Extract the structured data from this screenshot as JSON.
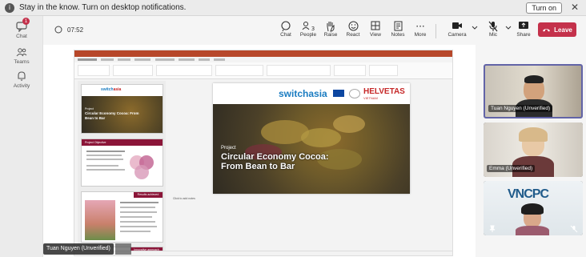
{
  "notification": {
    "text": "Stay in the know. Turn on desktop notifications.",
    "turn_on": "Turn on",
    "close": "✕",
    "info_glyph": "i"
  },
  "rail": {
    "items": [
      {
        "label": "Chat",
        "badge": "1",
        "icon": "chat-icon"
      },
      {
        "label": "Teams",
        "icon": "teams-icon"
      },
      {
        "label": "Activity",
        "icon": "bell-icon"
      }
    ]
  },
  "meeting": {
    "timer": "07:52",
    "toolbar": [
      {
        "label": "Chat",
        "icon": "chat-icon",
        "glyph": "💬"
      },
      {
        "label": "People",
        "icon": "people-icon",
        "glyph": "👥",
        "count": "3"
      },
      {
        "label": "Raise",
        "icon": "hand-icon",
        "glyph": "✋"
      },
      {
        "label": "React",
        "icon": "emoji-icon",
        "glyph": "☺"
      },
      {
        "label": "View",
        "icon": "grid-icon",
        "glyph": "⊞"
      },
      {
        "label": "Notes",
        "icon": "notes-icon",
        "glyph": "📄"
      },
      {
        "label": "More",
        "icon": "more-icon",
        "glyph": "···"
      },
      {
        "label": "Camera",
        "icon": "camera-icon",
        "glyph": "■"
      },
      {
        "label": "Mic",
        "icon": "mic-off-icon",
        "glyph": "🎙"
      },
      {
        "label": "Share",
        "icon": "share-icon",
        "glyph": "⬆"
      }
    ],
    "leave": "Leave",
    "leave_color": "#c4314b"
  },
  "presentation": {
    "main_slide": {
      "logo_left": "switchasia",
      "logo_right": "HELVETAS",
      "logo_right_sub": "VIETNAM",
      "kicker": "Project",
      "title_line1": "Circular Economy Cocoa:",
      "title_line2": "From Bean to Bar"
    },
    "thumb1": {
      "kicker": "Project",
      "title": "Circular Economy Cocoa: From Bean to Bar"
    },
    "thumb2": {
      "title": "Project Objective"
    },
    "thumb3": {
      "title": "Results achieved"
    },
    "thumb4": {
      "title": "Innovative approach"
    },
    "notes_placeholder": "Click to add notes"
  },
  "presenter": {
    "name": "Tuan Nguyen (Unverified)"
  },
  "participants": [
    {
      "name": "Tuan Nguyen (Unverified)"
    },
    {
      "name": "Emma (Unverified)"
    },
    {
      "name": "VNCPC"
    }
  ]
}
